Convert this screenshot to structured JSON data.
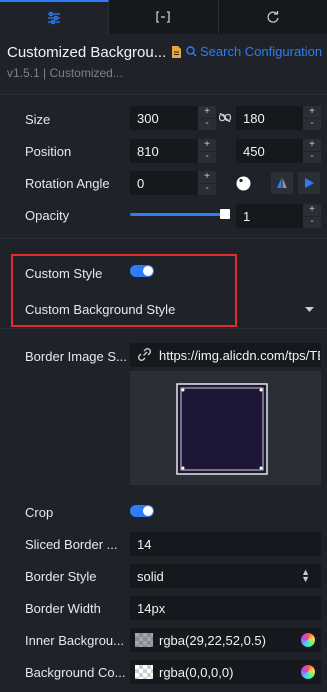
{
  "tabs": [
    {
      "icon": "sliders-icon",
      "active": true
    },
    {
      "icon": "brackets-icon",
      "active": false
    },
    {
      "icon": "refresh-icon",
      "active": false
    }
  ],
  "header": {
    "title": "Customized Backgrou...",
    "search_link": "Search Configuration",
    "version": "v1.5.1 | Customized..."
  },
  "props": {
    "size": {
      "label": "Size",
      "width": "300",
      "height": "180"
    },
    "position": {
      "label": "Position",
      "x": "810",
      "y": "450"
    },
    "rotation": {
      "label": "Rotation Angle",
      "value": "0"
    },
    "opacity": {
      "label": "Opacity",
      "value": "1",
      "level": 1
    }
  },
  "custom_style": {
    "toggle_label": "Custom Style",
    "toggle_on": true,
    "section_label": "Custom Background Style"
  },
  "background": {
    "border_image": {
      "label": "Border Image S...",
      "url": "https://img.alicdn.com/tps/TB"
    },
    "crop": {
      "label": "Crop",
      "on": true
    },
    "sliced_border": {
      "label": "Sliced Border ...",
      "value": "14"
    },
    "border_style": {
      "label": "Border Style",
      "value": "solid"
    },
    "border_width": {
      "label": "Border Width",
      "value": "14px"
    },
    "inner_background": {
      "label": "Inner Backgrou...",
      "value": "rgba(29,22,52,0.5)"
    },
    "background_color": {
      "label": "Background Co...",
      "value": "rgba(0,0,0,0)"
    }
  },
  "colors": {
    "accent": "#2e7cf6",
    "highlight": "#e32b2b"
  }
}
